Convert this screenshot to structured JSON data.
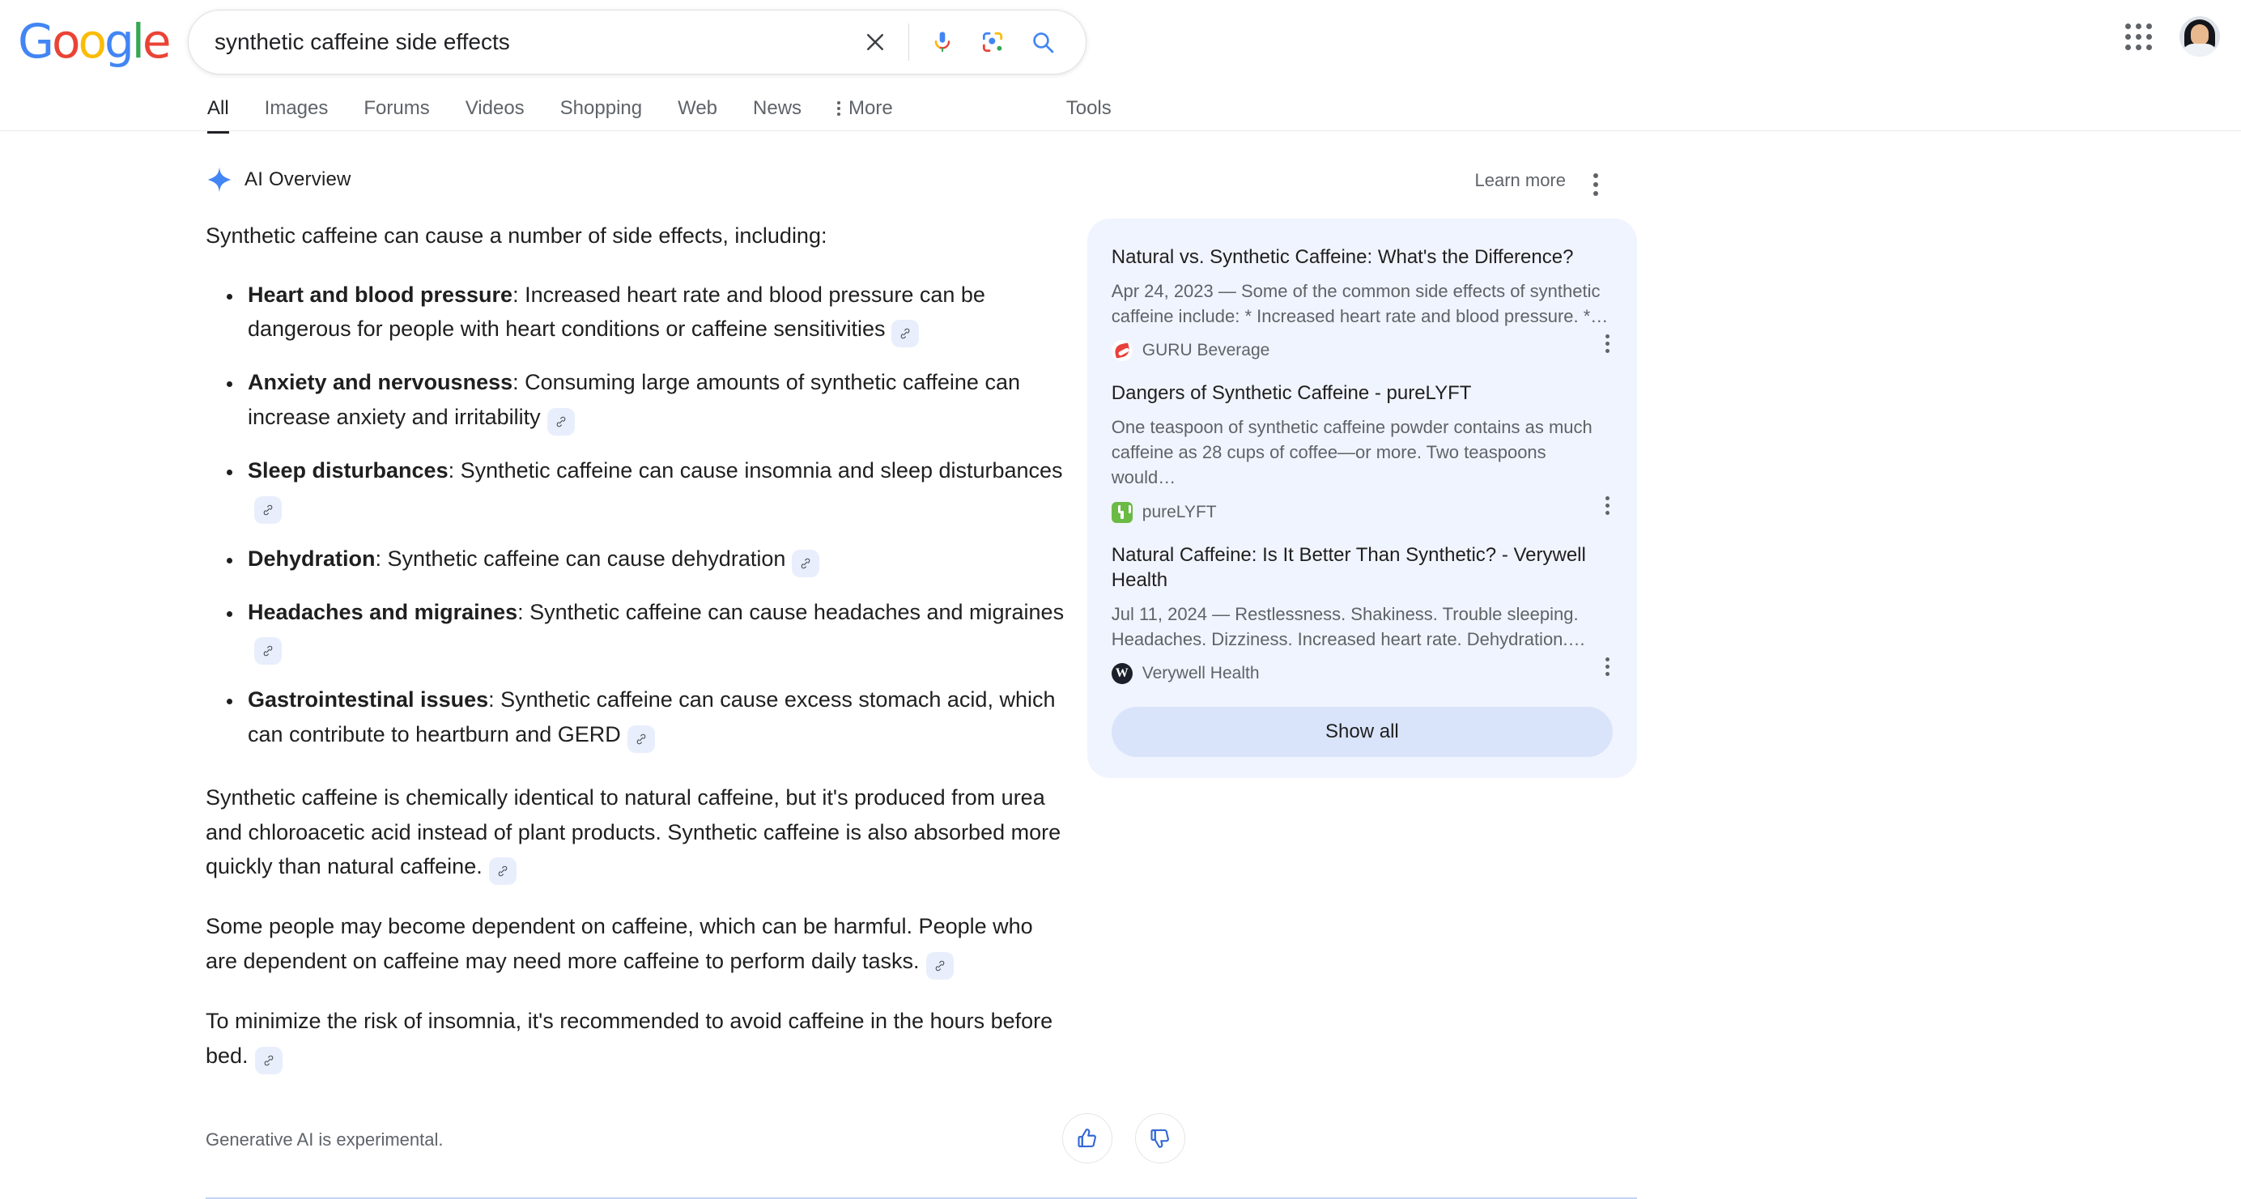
{
  "header": {
    "logo_letters": [
      "G",
      "o",
      "o",
      "g",
      "l",
      "e"
    ],
    "search_value": "synthetic caffeine side effects",
    "search_placeholder": "Search",
    "icons": {
      "clear": "close-icon",
      "voice": "microphone-icon",
      "lens": "google-lens-icon",
      "search": "search-icon",
      "apps": "apps-grid-icon",
      "account": "account-avatar"
    }
  },
  "nav": {
    "tabs": [
      {
        "label": "All",
        "active": true
      },
      {
        "label": "Images",
        "active": false
      },
      {
        "label": "Forums",
        "active": false
      },
      {
        "label": "Videos",
        "active": false
      },
      {
        "label": "Shopping",
        "active": false
      },
      {
        "label": "Web",
        "active": false
      },
      {
        "label": "News",
        "active": false
      }
    ],
    "more_label": "More",
    "tools_label": "Tools"
  },
  "ai_overview": {
    "title": "AI Overview",
    "learn_more": "Learn more",
    "intro": "Synthetic caffeine can cause a number of side effects, including:",
    "bullets": [
      {
        "term": "Heart and blood pressure",
        "text": ": Increased heart rate and blood pressure can be dangerous for people with heart conditions or caffeine sensitivities"
      },
      {
        "term": "Anxiety and nervousness",
        "text": ": Consuming large amounts of synthetic caffeine can increase anxiety and irritability"
      },
      {
        "term": "Sleep disturbances",
        "text": ": Synthetic caffeine can cause insomnia and sleep disturbances"
      },
      {
        "term": "Dehydration",
        "text": ": Synthetic caffeine can cause dehydration"
      },
      {
        "term": "Headaches and migraines",
        "text": ": Synthetic caffeine can cause headaches and migraines"
      },
      {
        "term": "Gastrointestinal issues",
        "text": ": Synthetic caffeine can cause excess stomach acid, which can contribute to heartburn and GERD"
      }
    ],
    "paragraphs": [
      "Synthetic caffeine is chemically identical to natural caffeine, but it's produced from urea and chloroacetic acid instead of plant products. Synthetic caffeine is also absorbed more quickly than natural caffeine.",
      "Some people may become dependent on caffeine, which can be harmful. People who are dependent on caffeine may need more caffeine to perform daily tasks.",
      "To minimize the risk of insomnia, it's recommended to avoid caffeine in the hours before bed."
    ],
    "disclaimer": "Generative AI is experimental.",
    "feedback": {
      "up": "thumb-up-icon",
      "down": "thumb-down-icon"
    }
  },
  "sources": {
    "show_all_label": "Show all",
    "cards": [
      {
        "title": "Natural vs. Synthetic Caffeine: What's the Difference?",
        "snippet": "Apr 24, 2023 — Some of the common side effects of synthetic caffeine include: * Increased heart rate and blood pressure. *…",
        "site": "GURU Beverage"
      },
      {
        "title": "Dangers of Synthetic Caffeine - pureLYFT",
        "snippet": "One teaspoon of synthetic caffeine powder contains as much caffeine as 28 cups of coffee—or more. Two teaspoons would…",
        "site": "pureLYFT"
      },
      {
        "title": "Natural Caffeine: Is It Better Than Synthetic? - Verywell Health",
        "snippet": "Jul 11, 2024 — Restlessness. Shakiness. Trouble sleeping. Headaches. Dizziness. Increased heart rate. Dehydration.…",
        "site": "Verywell Health"
      }
    ]
  },
  "colors": {
    "google_blue": "#4285f4",
    "google_red": "#ea4335",
    "google_yellow": "#fbbc05",
    "google_green": "#34a853",
    "panel_bg": "#f0f4fe",
    "show_all_bg": "#d9e4fb",
    "cite_bg": "#e8eefc",
    "divider": "#c3d4f5"
  }
}
